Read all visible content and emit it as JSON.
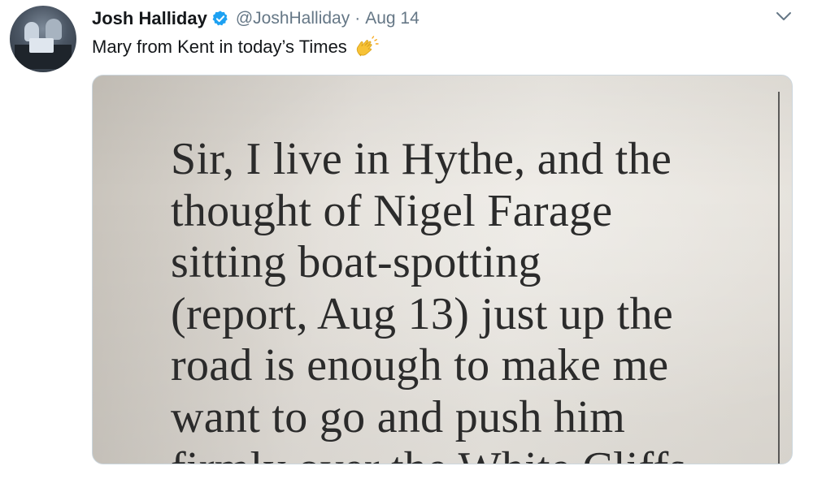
{
  "tweet": {
    "author_name": "Josh Halliday",
    "handle": "@JoshHalliday",
    "separator": "·",
    "date": "Aug 14",
    "text": "Mary from Kent in today’s Times",
    "emoji": "clapping-hands-icon",
    "verified": true
  },
  "photo": {
    "lines": [
      "Sir, I live in Hythe, and the",
      "thought of Nigel Farage",
      "sitting boat-spotting",
      "(report, Aug 13) just up the",
      "road is enough to make me",
      "want to go and push him",
      "firmly over the White Cliffs"
    ]
  },
  "colors": {
    "verified_blue": "#1da1f2",
    "text_primary": "#14171a",
    "text_secondary": "#657786"
  }
}
